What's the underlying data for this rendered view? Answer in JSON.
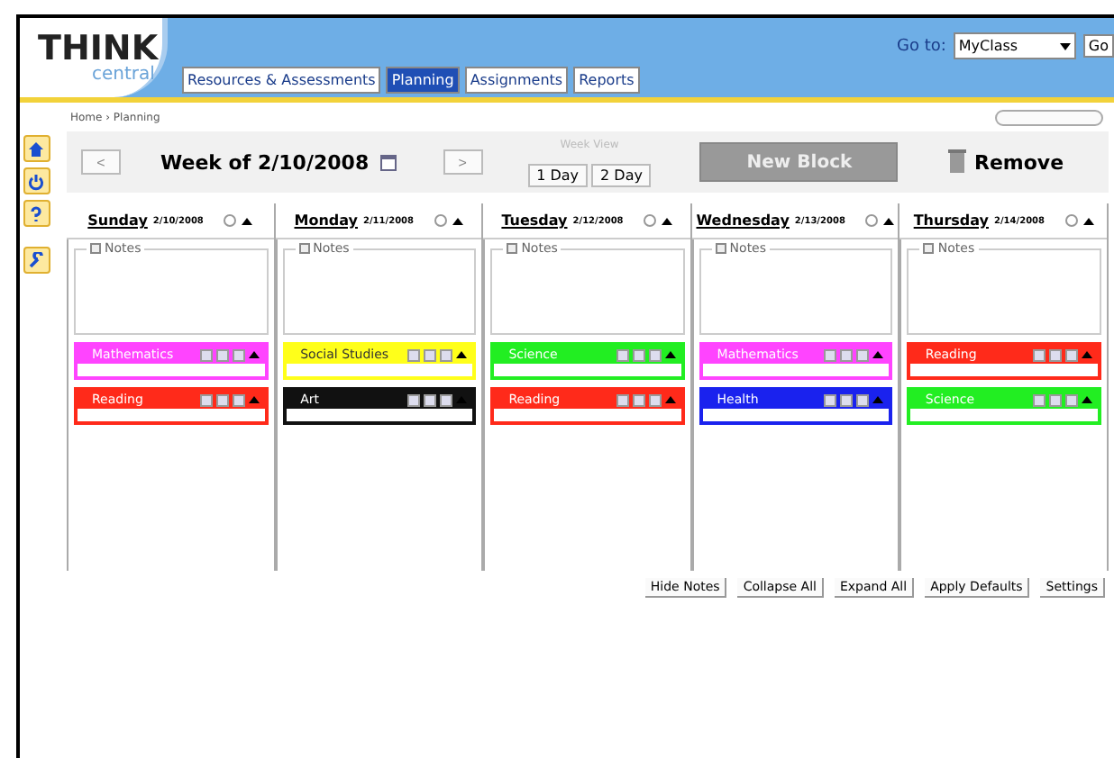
{
  "logo": {
    "word": "THINK",
    "sub": "central"
  },
  "nav_tabs": [
    {
      "label": "Resources & Assessments",
      "selected": false
    },
    {
      "label": "Planning",
      "selected": true
    },
    {
      "label": "Assignments",
      "selected": false
    },
    {
      "label": "Reports",
      "selected": false
    }
  ],
  "goto": {
    "label": "Go to:",
    "value": "MyClass",
    "button": "Go"
  },
  "breadcrumb": "Home › Planning",
  "toolbar": {
    "prev": "<",
    "week": "Week of 2/10/2008",
    "next": ">",
    "view_label": "Week View",
    "view_buttons": [
      "1 Day",
      "2 Day"
    ],
    "new_block": "New Block",
    "remove": "Remove"
  },
  "days": [
    {
      "name": "Sunday",
      "date": "2/10/2008",
      "notes": "Notes",
      "blocks": [
        {
          "name": "Mathematics",
          "color": "#ff44ff"
        },
        {
          "name": "Reading",
          "color": "#ff2a1a"
        }
      ]
    },
    {
      "name": "Monday",
      "date": "2/11/2008",
      "notes": "Notes",
      "blocks": [
        {
          "name": "Social Studies",
          "color": "#ffff1a"
        },
        {
          "name": "Art",
          "color": "#111111"
        }
      ]
    },
    {
      "name": "Tuesday",
      "date": "2/12/2008",
      "notes": "Notes",
      "blocks": [
        {
          "name": "Science",
          "color": "#22ee22"
        },
        {
          "name": "Reading",
          "color": "#ff2a1a"
        }
      ]
    },
    {
      "name": "Wednesday",
      "date": "2/13/2008",
      "notes": "Notes",
      "blocks": [
        {
          "name": "Mathematics",
          "color": "#ff44ff"
        },
        {
          "name": "Health",
          "color": "#1a22ee"
        }
      ]
    },
    {
      "name": "Thursday",
      "date": "2/14/2008",
      "notes": "Notes",
      "blocks": [
        {
          "name": "Reading",
          "color": "#ff2a1a"
        },
        {
          "name": "Science",
          "color": "#22ee22"
        }
      ]
    }
  ],
  "footer_buttons": [
    "Hide Notes",
    "Collapse All",
    "Expand All",
    "Apply Defaults",
    "Settings"
  ]
}
